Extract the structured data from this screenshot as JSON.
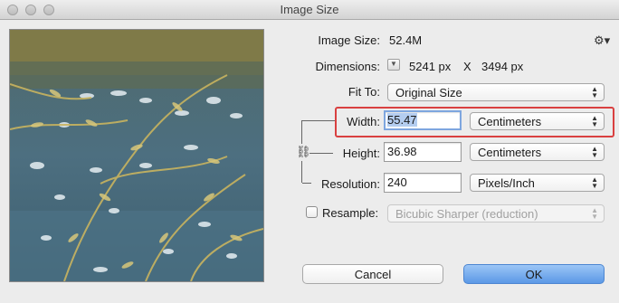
{
  "window": {
    "title": "Image Size"
  },
  "info": {
    "image_size_label": "Image Size:",
    "image_size_value": "52.4M",
    "dimensions_label": "Dimensions:",
    "dimensions_width": "5241 px",
    "dimensions_sep": "X",
    "dimensions_height": "3494 px"
  },
  "fit_to": {
    "label": "Fit To:",
    "value": "Original Size"
  },
  "width": {
    "label": "Width:",
    "value": "55.47",
    "unit": "Centimeters"
  },
  "height": {
    "label": "Height:",
    "value": "36.98",
    "unit": "Centimeters"
  },
  "resolution": {
    "label": "Resolution:",
    "value": "240",
    "unit": "Pixels/Inch"
  },
  "resample": {
    "label": "Resample:",
    "checked": false,
    "method": "Bicubic Sharper (reduction)"
  },
  "buttons": {
    "cancel": "Cancel",
    "ok": "OK"
  },
  "colors": {
    "highlight": "#d94040",
    "ok_button": "#5b98e6",
    "selection": "#b4cdf0"
  },
  "icons": {
    "gear": "gear-icon",
    "link": "chain-link-icon",
    "dimension_menu": "triangle-down-icon"
  }
}
